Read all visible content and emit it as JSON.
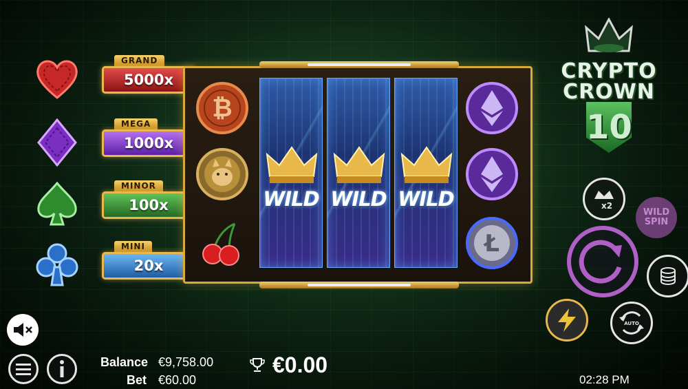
{
  "game": {
    "title_line1": "CRYPTO",
    "title_line2": "CROWN",
    "title_number": "10"
  },
  "jackpots": [
    {
      "name": "GRAND",
      "value": "5000x",
      "suit": "heart-icon",
      "color": "#c62828"
    },
    {
      "name": "MEGA",
      "value": "1000x",
      "suit": "diamond-icon",
      "color": "#7b2fc2"
    },
    {
      "name": "MINOR",
      "value": "100x",
      "suit": "spade-icon",
      "color": "#2e8b2e"
    },
    {
      "name": "MINI",
      "value": "20x",
      "suit": "club-icon",
      "color": "#2a6fc9"
    }
  ],
  "reels": {
    "reel1": [
      "bitcoin-coin",
      "dogecoin-coin",
      "cherries"
    ],
    "reel2_4": "wild-crown",
    "reel5": [
      "ethereum-coin",
      "ethereum-coin",
      "litecoin-coin"
    ],
    "wild_label": "WILD"
  },
  "controls": {
    "multiplier_label": "x2",
    "wild_spin_line1": "WILD",
    "wild_spin_line2": "SPIN",
    "auto_label": "AUTO"
  },
  "footer": {
    "balance_label": "Balance",
    "balance_value": "€9,758.00",
    "bet_label": "Bet",
    "bet_value": "€60.00",
    "win_value": "€0.00",
    "clock": "02:28 PM"
  },
  "colors": {
    "gold": "#e8b84a",
    "spin_ring": "#b05fc6",
    "background": "#0f2a17"
  }
}
